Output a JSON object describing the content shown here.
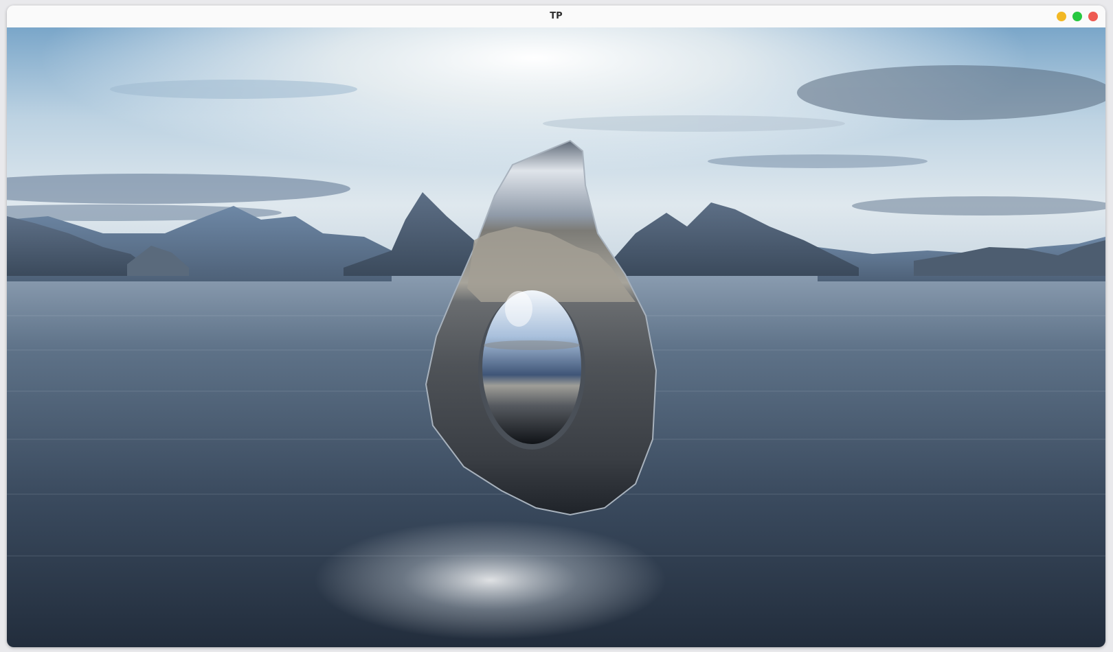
{
  "window": {
    "title": "TP"
  },
  "controls": [
    {
      "name": "minimize",
      "color": "#f2b824"
    },
    {
      "name": "maximize",
      "color": "#27c840"
    },
    {
      "name": "close",
      "color": "#ee5a52"
    }
  ],
  "scene": {
    "objects": [
      "skybox",
      "mountains",
      "water",
      "reflective-surface",
      "reflective-egg"
    ]
  }
}
